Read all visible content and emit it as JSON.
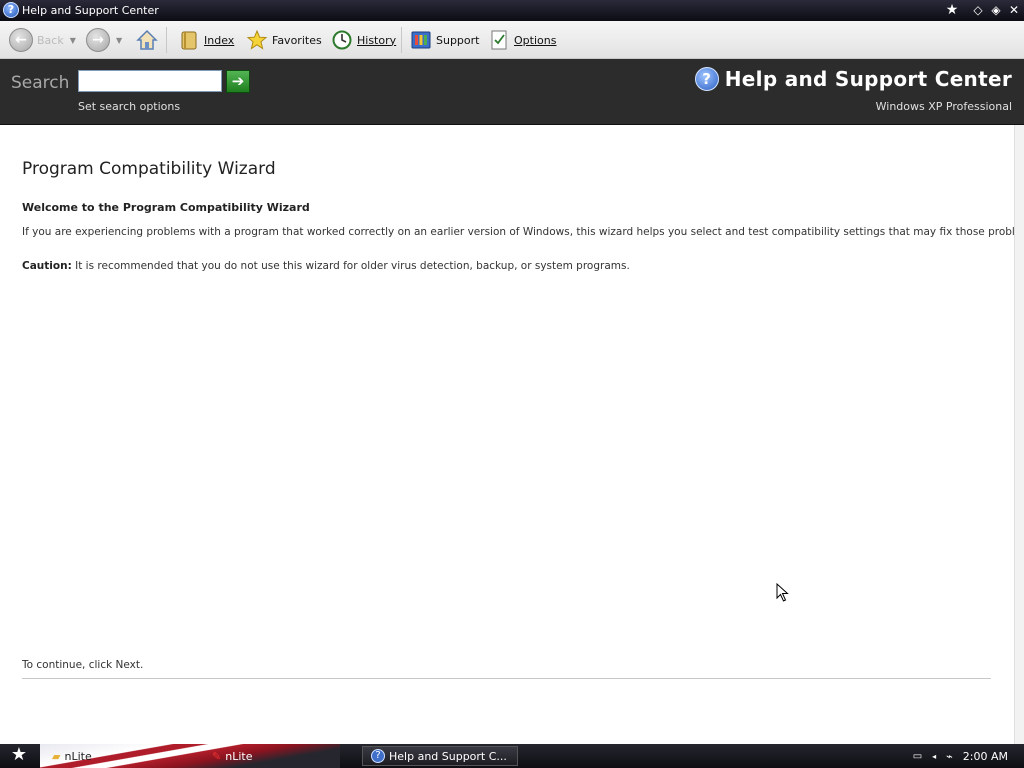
{
  "window": {
    "title": "Help and Support Center"
  },
  "toolbar": {
    "back": "Back",
    "forward": "Forward",
    "home": "Home",
    "index": "Index",
    "favorites": "Favorites",
    "history": "History",
    "support": "Support",
    "options": "Options"
  },
  "header": {
    "search_label": "Search",
    "search_value": "",
    "search_options": "Set search options",
    "app_title": "Help and Support Center",
    "edition": "Windows XP Professional"
  },
  "content": {
    "heading": "Program Compatibility Wizard",
    "welcome": "Welcome to the Program Compatibility Wizard",
    "intro": "If you are experiencing problems with a program that worked correctly on an earlier version of Windows, this wizard helps you select and test compatibility settings that may fix those problems.",
    "caution_label": "Caution:",
    "caution_text": "It is recommended that you do not use this wizard for older virus detection, backup, or system programs.",
    "continue_text": "To continue, click Next."
  },
  "taskbar": {
    "tasks": [
      {
        "label": "nLite",
        "icon": "folder-icon"
      },
      {
        "label": "nLite",
        "icon": "nlite-icon"
      },
      {
        "label": "Help and Support C...",
        "icon": "help-icon"
      }
    ],
    "clock": "2:00 AM"
  }
}
